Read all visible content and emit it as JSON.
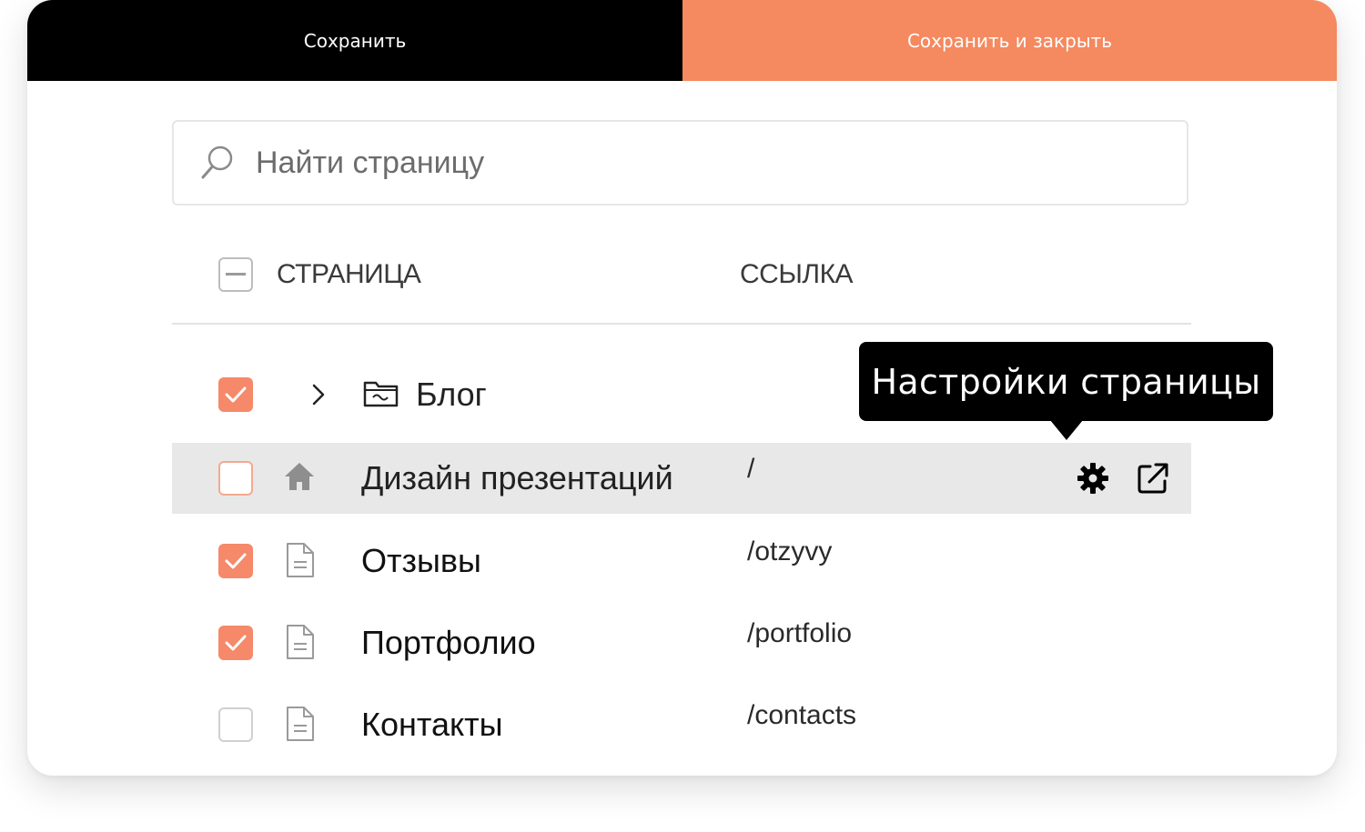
{
  "toolbar": {
    "save_label": "Сохранить",
    "save_close_label": "Сохранить и закрыть",
    "accent_color": "#f5895f"
  },
  "search": {
    "placeholder": "Найти страницу"
  },
  "table": {
    "columns": [
      "СТРАНИЦА",
      "ССЫЛКА"
    ],
    "rows": [
      {
        "title": "Блог",
        "link": "",
        "icon": "folder-icon",
        "checked": true,
        "expandable": true
      },
      {
        "title": "Дизайн презентаций",
        "link": "/",
        "icon": "home-icon",
        "checked": false,
        "hovered": true
      },
      {
        "title": "Отзывы",
        "link": "/otzyvy",
        "icon": "document-icon",
        "checked": true
      },
      {
        "title": "Портфолио",
        "link": "/portfolio",
        "icon": "document-icon",
        "checked": true
      },
      {
        "title": "Контакты",
        "link": "/contacts",
        "icon": "document-icon",
        "checked": false
      }
    ]
  },
  "tooltip": {
    "text": "Настройки страницы"
  }
}
